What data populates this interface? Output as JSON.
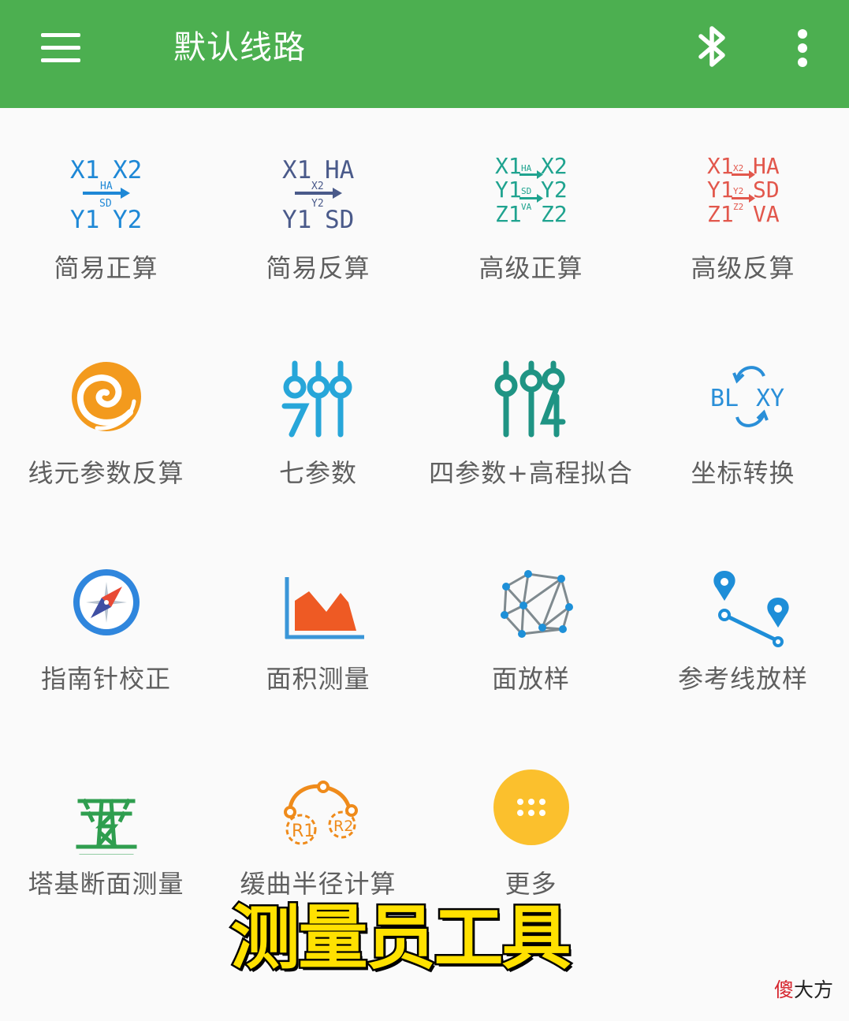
{
  "appbar": {
    "title": "默认线路",
    "color": "#4caf50",
    "left_icon": "menu-icon",
    "right_icons": [
      "bluetooth-icon",
      "more-vert-icon"
    ]
  },
  "icon_text": {
    "simple_forward": {
      "x1": "X1",
      "x2": "X2",
      "ha": "HA",
      "sd": "SD",
      "y1": "Y1",
      "y2": "Y2"
    },
    "simple_inverse": {
      "x1": "X1",
      "ha": "HA",
      "x2": "X2",
      "y2": "Y2",
      "y1": "Y1",
      "sd": "SD"
    },
    "advanced_forward": {
      "x1": "X1",
      "x2": "X2",
      "ha": "HA",
      "y1": "Y1",
      "sd": "SD",
      "y2": "Y2",
      "z1": "Z1",
      "va": "VA",
      "z2": "Z2"
    },
    "advanced_inverse": {
      "x1": "X1",
      "x2": "X2",
      "ha": "HA",
      "y1": "Y1",
      "y2": "Y2",
      "sd": "SD",
      "z1": "Z1",
      "z2": "Z2",
      "va": "VA"
    },
    "coord_convert": {
      "bl": "BL",
      "xy": "XY"
    },
    "transition_curve": {
      "r1": "R1",
      "r2": "R2"
    }
  },
  "grid": [
    {
      "label": "简易正算",
      "icon": "simple-forward-icon"
    },
    {
      "label": "简易反算",
      "icon": "simple-inverse-icon"
    },
    {
      "label": "高级正算",
      "icon": "advanced-forward-icon"
    },
    {
      "label": "高级反算",
      "icon": "advanced-inverse-icon"
    },
    {
      "label": "线元参数反算",
      "icon": "spiral-icon"
    },
    {
      "label": "七参数",
      "icon": "seven-parameter-sliders-icon"
    },
    {
      "label": "四参数+高程拟合",
      "icon": "four-parameter-sliders-icon"
    },
    {
      "label": "坐标转换",
      "icon": "coordinate-convert-icon"
    },
    {
      "label": "指南针校正",
      "icon": "compass-icon"
    },
    {
      "label": "面积测量",
      "icon": "area-chart-icon"
    },
    {
      "label": "面放样",
      "icon": "mesh-network-icon"
    },
    {
      "label": "参考线放样",
      "icon": "reference-line-icon"
    },
    {
      "label": "塔基断面测量",
      "icon": "power-tower-icon"
    },
    {
      "label": "缓曲半径计算",
      "icon": "curve-radius-icon"
    },
    {
      "label": "更多",
      "icon": "more-apps-icon"
    }
  ],
  "caption": "测量员工具",
  "watermark": {
    "part1": "傻",
    "part2": "大方"
  }
}
